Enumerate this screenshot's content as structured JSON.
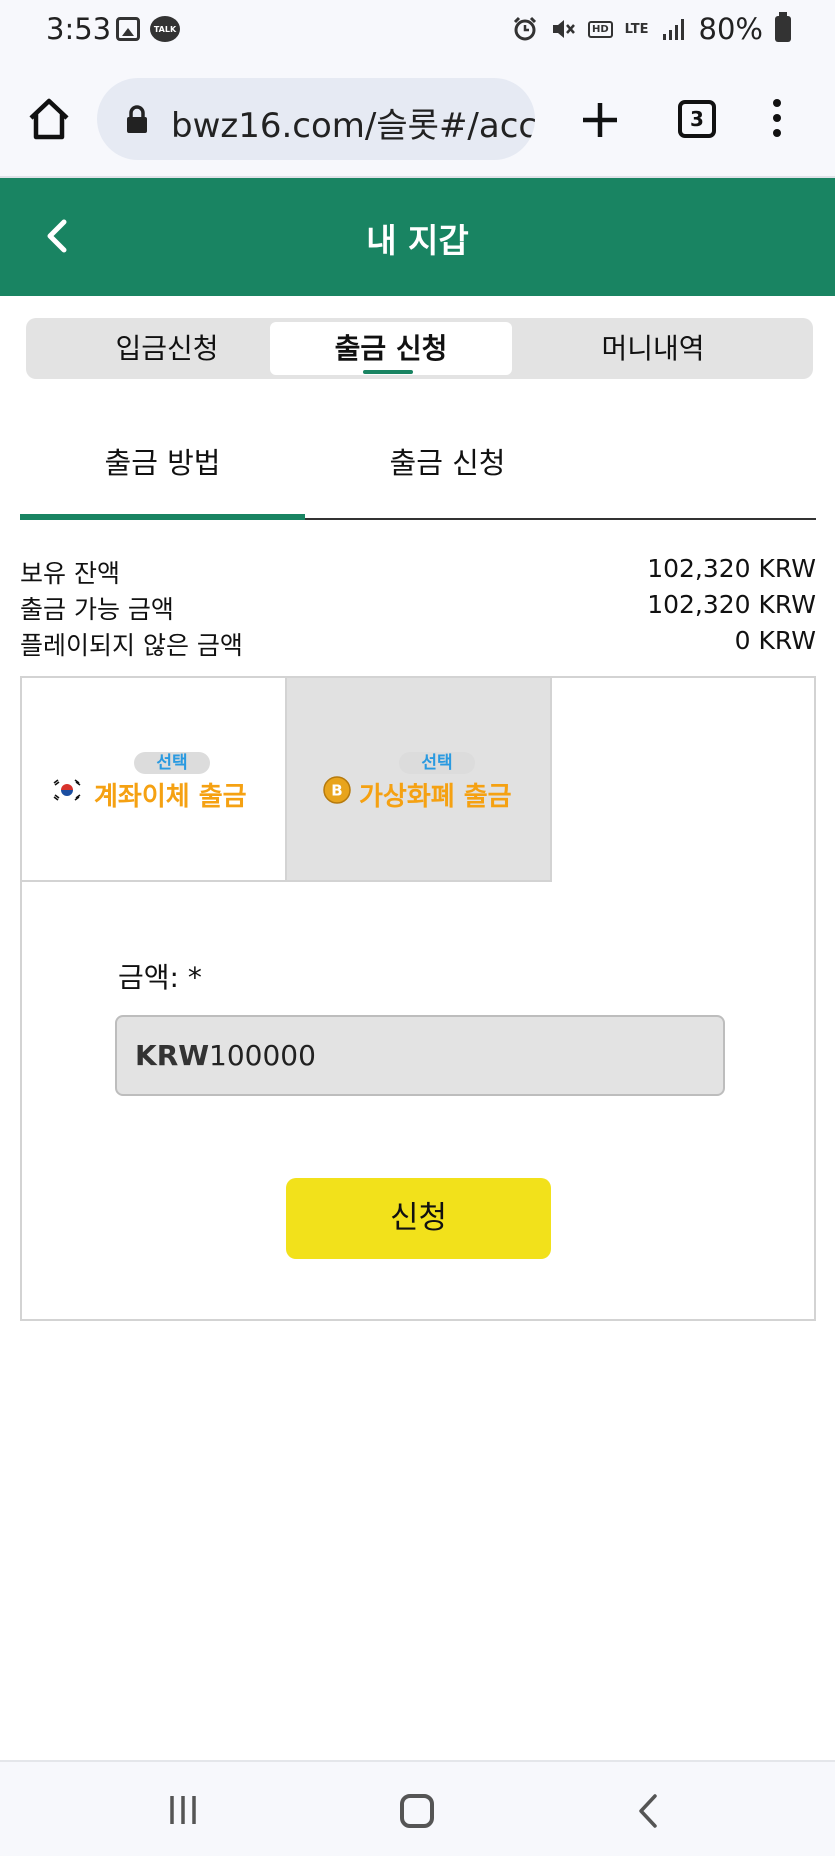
{
  "status_bar": {
    "time": "3:53",
    "battery": "80%",
    "hd_label": "HD",
    "lte_label": "LTE",
    "talk_label": "TALK"
  },
  "browser": {
    "url": "bwz16.com/슬롯#/acc",
    "tab_count": "3"
  },
  "header": {
    "title": "내 지갑"
  },
  "segment_tabs": [
    {
      "label": "입금신청",
      "active": false
    },
    {
      "label": "출금 신청",
      "active": true
    },
    {
      "label": "머니내역",
      "active": false
    }
  ],
  "sub_tabs": [
    {
      "label": "출금 방법",
      "active": true
    },
    {
      "label": "출금 신청",
      "active": false
    }
  ],
  "balances": [
    {
      "label": "보유 잔액",
      "value": "102,320 KRW"
    },
    {
      "label": "출금 가능 금액",
      "value": "102,320 KRW"
    },
    {
      "label": "플레이되지 않은 금액",
      "value": "0 KRW"
    }
  ],
  "methods": [
    {
      "tag": "선택",
      "label": "계좌이체 출금",
      "icon": "korea-flag-icon"
    },
    {
      "tag": "선택",
      "label": "가상화폐 출금",
      "icon": "bitcoin-icon"
    }
  ],
  "form": {
    "amount_label": "금액: *",
    "currency": "KRW",
    "amount_value": "100000",
    "submit_label": "신청"
  },
  "colors": {
    "header_green": "#198462",
    "method_label": "#f5a112",
    "method_tag": "#2a9ae0",
    "submit_yellow": "#f2e11b"
  }
}
